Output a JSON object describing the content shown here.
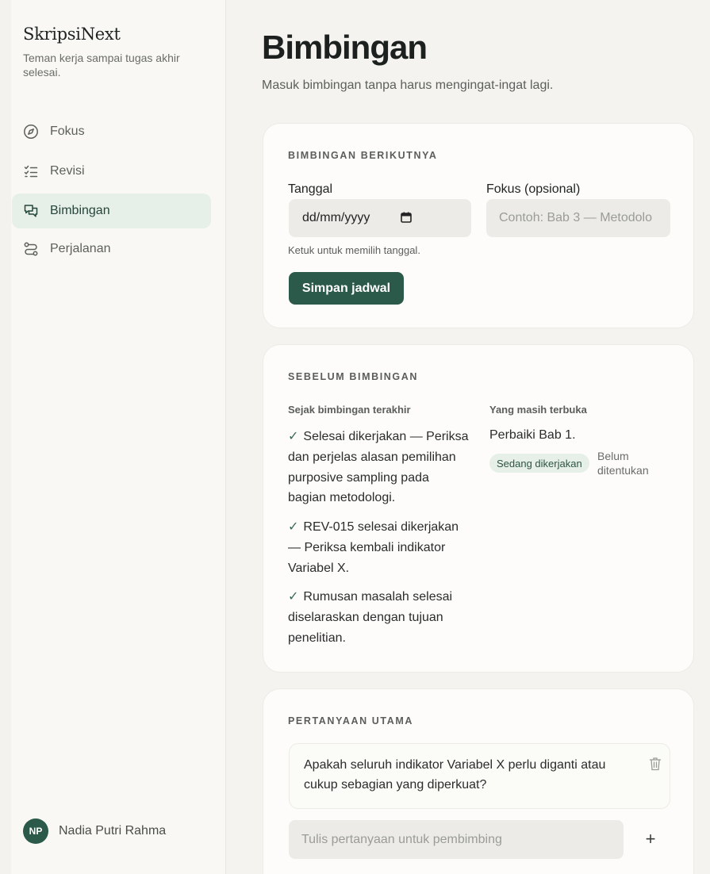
{
  "brand": {
    "name": "SkripsiNext",
    "tagline": "Teman kerja sampai tugas akhir selesai."
  },
  "nav": {
    "items": [
      {
        "label": "Fokus",
        "icon": "compass-icon",
        "active": false
      },
      {
        "label": "Revisi",
        "icon": "checklist-icon",
        "active": false
      },
      {
        "label": "Bimbingan",
        "icon": "chat-bubbles-icon",
        "active": true
      },
      {
        "label": "Perjalanan",
        "icon": "route-icon",
        "active": false
      }
    ]
  },
  "user": {
    "initials": "NP",
    "name": "Nadia Putri Rahma"
  },
  "page": {
    "title": "Bimbingan",
    "subtitle": "Masuk bimbingan tanpa harus mengingat-ingat lagi."
  },
  "next_session": {
    "section_label": "BIMBINGAN BERIKUTNYA",
    "date_label": "Tanggal",
    "date_placeholder": "dd/mm/yyyy",
    "focus_label": "Fokus (opsional)",
    "focus_placeholder": "Contoh: Bab 3 — Metodolo",
    "hint": "Ketuk untuk memilih tanggal.",
    "save_button": "Simpan jadwal"
  },
  "before_session": {
    "section_label": "SEBELUM BIMBINGAN",
    "since_last_label": "Sejak bimbingan terakhir",
    "open_label": "Yang masih terbuka",
    "done_items": [
      {
        "check": "✓",
        "text": "Selesai dikerjakan — Periksa dan perjelas alasan pemilihan purposive sampling pada bagian metodologi."
      },
      {
        "check": "✓",
        "text": "REV-015 selesai dikerjakan — Periksa kembali indikator Variabel X."
      },
      {
        "check": "✓",
        "text": "Rumusan masalah selesai diselaraskan dengan tujuan penelitian."
      }
    ],
    "open_items": [
      {
        "title": "Perbaiki Bab 1.",
        "status": "Sedang dikerjakan",
        "due": "Belum ditentukan"
      }
    ]
  },
  "main_questions": {
    "section_label": "PERTANYAAN UTAMA",
    "questions": [
      {
        "text": "Apakah seluruh indikator Variabel X perlu diganti atau cukup sebagian yang diperkuat?"
      }
    ],
    "input_placeholder": "Tulis pertanyaan untuk pembimbing",
    "add_symbol": "+"
  },
  "colors": {
    "accent": "#2c5a4a",
    "active_nav_bg": "#e6efe8",
    "page_bg": "#f4f3ef",
    "card_bg": "#fdfcfa"
  }
}
